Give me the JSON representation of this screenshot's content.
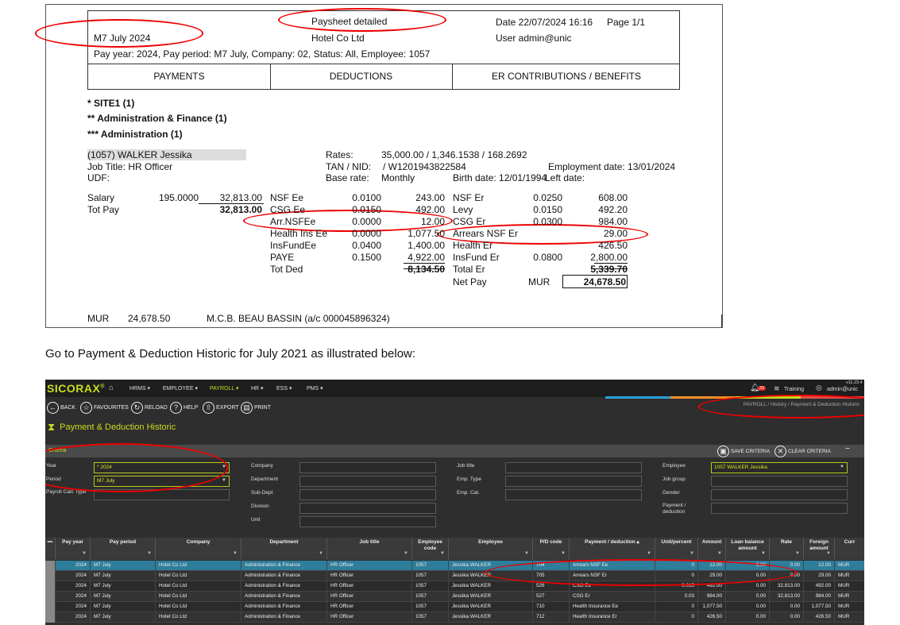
{
  "report": {
    "title": "Paysheet detailed",
    "period": "M7 July 2024",
    "company": "Hotel Co Ltd",
    "date": "Date  22/07/2024 16:16",
    "page": "Page 1/1",
    "user": "User  admin@unic",
    "params": "Pay year: 2024, Pay period: M7 July, Company: 02, Status: All, Employee: 1057",
    "columns": [
      "PAYMENTS",
      "DEDUCTIONS",
      "ER CONTRIBUTIONS / BENEFITS"
    ],
    "groups": [
      "* SITE1 (1)",
      "** Administration & Finance (1)",
      "*** Administration (1)"
    ],
    "employee": {
      "name": "(1057) WALKER Jessika",
      "job": "Job Title:  HR Officer",
      "udf": "UDF:",
      "rates_label": "Rates:",
      "rates_value": "35,000.00 / 1,346.1538 / 168.2692",
      "tan_label": "TAN / NID:",
      "tan_value": "/ W1201943822584",
      "base_label": "Base rate:",
      "base_value": "Monthly",
      "birth": "Birth date:  12/01/1994",
      "leave": "Left date:",
      "employment": "Employment date:  13/01/2024"
    },
    "payments": [
      {
        "label": "Salary",
        "rate": "195.0000",
        "amount": "32,813.00"
      },
      {
        "label": "Tot Pay",
        "rate": "",
        "amount": "32,813.00"
      }
    ],
    "deductions": [
      {
        "label": "NSF Ee",
        "rate": "0.0100",
        "amount": "243.00"
      },
      {
        "label": "CSG Ee",
        "rate": "0.0150",
        "amount": "492.00"
      },
      {
        "label": "Arr.NSFEe",
        "rate": "0.0000",
        "amount": "12.00"
      },
      {
        "label": "Health Ins Ee",
        "rate": "0.0000",
        "amount": "1,077.50"
      },
      {
        "label": "InsFundEe",
        "rate": "0.0400",
        "amount": "1,400.00"
      },
      {
        "label": "PAYE",
        "rate": "0.1500",
        "amount": "4,922.00"
      },
      {
        "label": "Tot Ded",
        "rate": "",
        "amount": "8,134.50"
      }
    ],
    "er": [
      {
        "label": "NSF Er",
        "rate": "0.0250",
        "amount": "608.00"
      },
      {
        "label": "Levy",
        "rate": "0.0150",
        "amount": "492.20"
      },
      {
        "label": "CSG Er",
        "rate": "0.0300",
        "amount": "984.00"
      },
      {
        "label": "Arrears NSF Er",
        "rate": "",
        "amount": "29.00"
      },
      {
        "label": "Health Er",
        "rate": "",
        "amount": "426.50"
      },
      {
        "label": "InsFund Er",
        "rate": "0.0800",
        "amount": "2,800.00"
      },
      {
        "label": "Total Er",
        "rate": "",
        "amount": "5,339.70"
      }
    ],
    "net_pay_label": "Net Pay",
    "net_pay_currency": "MUR",
    "net_pay_amount": "24,678.50",
    "bank_currency": "MUR",
    "bank_amount": "24,678.50",
    "bank_name": "M.C.B. BEAU BASSIN (a/c 000045896324)"
  },
  "instruction": "Go to Payment & Deduction Historic for July 2021 as illustrated below:",
  "app": {
    "brand": "SICORAX",
    "brand_mark": "®",
    "version": "v11.23.4",
    "nav": [
      "HRMS ▾",
      "EMPLOYEE ▾",
      "PAYROLL ▾",
      "HR ▾",
      "ESS ▾",
      "PMS ▾"
    ],
    "notif_count": "33",
    "training": "Training",
    "user": "admin@unic",
    "toolbar": [
      "BACK",
      "FAVOURITES",
      "RELOAD",
      "HELP",
      "EXPORT",
      "PRINT"
    ],
    "breadcrumb": "PAYROLL /  History /  Payment & Deduction Historic",
    "page_title": "Payment & Deduction Historic",
    "criteria_label": "Criteria",
    "save_criteria": "SAVE CRITERIA",
    "clear_criteria": "CLEAR CRITERIA",
    "collapse": "−",
    "filters": {
      "year_label": "Year",
      "year_value": "*  2024",
      "period_label": "Period",
      "period_value": "M7 July",
      "calc_label": "Payroll Calc Type",
      "company_label": "Company",
      "department_label": "Department",
      "subdept_label": "Sub-Dept",
      "division_label": "Division",
      "unit_label": "Unit",
      "jobtitle_label": "Job title",
      "emptype_label": "Emp. Type",
      "empcat_label": "Emp. Cat.",
      "employee_label": "Employee",
      "employee_value": "1057 WALKER Jessika",
      "jobgroup_label": "Job group",
      "gender_label": "Gender",
      "pd_label_1": "Payment /",
      "pd_label_2": "deduction"
    },
    "grid": {
      "menu": "•••",
      "columns": [
        "Pay year",
        "Pay period",
        "Company",
        "Department",
        "Job title",
        "Employee code",
        "Employee",
        "P/D code",
        "Payment / deduction ▴",
        "Unit/percent",
        "Amount",
        "Loan balance amount",
        "Rate",
        "Foreign amount",
        "Curr"
      ],
      "rows": [
        [
          "2024",
          "M7 July",
          "Hotel Co Ltd",
          "Administration & Finance",
          "HR Officer",
          "1057",
          "Jessika WALKER",
          "704",
          "Arrears NSF Ee",
          "0",
          "12.00",
          "0.00",
          "0.00",
          "12.00",
          "MUR"
        ],
        [
          "2024",
          "M7 July",
          "Hotel Co Ltd",
          "Administration & Finance",
          "HR Officer",
          "1057",
          "Jessika WALKER",
          "705",
          "Arrears NSF Er",
          "0",
          "29.00",
          "0.00",
          "0.00",
          "29.00",
          "MUR"
        ],
        [
          "2024",
          "M7 July",
          "Hotel Co Ltd",
          "Administration & Finance",
          "HR Officer",
          "1057",
          "Jessika WALKER",
          "526",
          "CSG Ee",
          "0.015",
          "492.00",
          "0.00",
          "32,813.00",
          "492.00",
          "MUR"
        ],
        [
          "2024",
          "M7 July",
          "Hotel Co Ltd",
          "Administration & Finance",
          "HR Officer",
          "1057",
          "Jessika WALKER",
          "527",
          "CSG Er",
          "0.03",
          "984.00",
          "0.00",
          "32,813.00",
          "984.00",
          "MUR"
        ],
        [
          "2024",
          "M7 July",
          "Hotel Co Ltd",
          "Administration & Finance",
          "HR Officer",
          "1057",
          "Jessika WALKER",
          "710",
          "Health Insurance Ee",
          "0",
          "1,077.50",
          "0.00",
          "0.00",
          "1,077.50",
          "MUR"
        ],
        [
          "2024",
          "M7 July",
          "Hotel Co Ltd",
          "Administration & Finance",
          "HR Officer",
          "1057",
          "Jessika WALKER",
          "712",
          "Health Insurance Er",
          "0",
          "426.50",
          "0.00",
          "0.00",
          "426.50",
          "MUR"
        ]
      ]
    }
  },
  "colors": {
    "accent": "#c8dc1e",
    "annotation": "#e00000",
    "selected_row": "#2e7d9a"
  }
}
